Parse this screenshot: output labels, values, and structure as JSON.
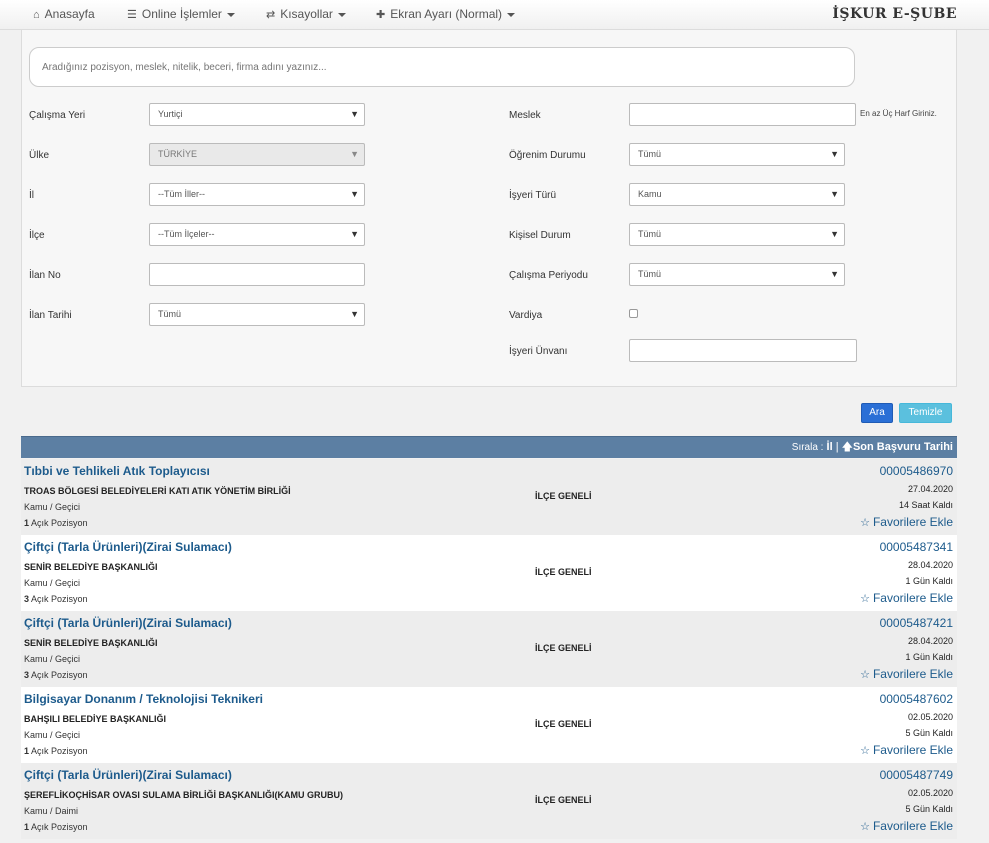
{
  "navbar": {
    "items": [
      {
        "label": "Anasayfa",
        "icon": "home-icon"
      },
      {
        "label": "Online İşlemler",
        "icon": "list-icon"
      },
      {
        "label": "Kısayollar",
        "icon": "shuffle-icon"
      },
      {
        "label": "Ekran Ayarı (Normal)",
        "icon": "expand-icon"
      }
    ],
    "brand": "İŞKUR E-ŞUBE"
  },
  "search": {
    "placeholder": "Aradığınız pozisyon, meslek, nitelik, beceri, firma adını yazınız..."
  },
  "filters": {
    "calisma_yeri": {
      "label": "Çalışma Yeri",
      "value": "Yurtiçi"
    },
    "ulke": {
      "label": "Ülke",
      "value": "TÜRKİYE"
    },
    "il": {
      "label": "İl",
      "value": "--Tüm İller--"
    },
    "ilce": {
      "label": "İlçe",
      "value": "--Tüm İlçeler--"
    },
    "ilan_no": {
      "label": "İlan No",
      "value": ""
    },
    "ilan_tarihi": {
      "label": "İlan Tarihi",
      "value": "Tümü"
    },
    "meslek": {
      "label": "Meslek",
      "value": "",
      "hint": "En az Üç Harf Giriniz."
    },
    "ogrenim_durumu": {
      "label": "Öğrenim Durumu",
      "value": "Tümü"
    },
    "isyeri_turu": {
      "label": "İşyeri Türü",
      "value": "Kamu"
    },
    "kisisel_durum": {
      "label": "Kişisel Durum",
      "value": "Tümü"
    },
    "calisma_periyodu": {
      "label": "Çalışma Periyodu",
      "value": "Tümü"
    },
    "vardiya": {
      "label": "Vardiya",
      "checked": false
    },
    "isyeri_unvani": {
      "label": "İşyeri Ünvanı",
      "value": ""
    }
  },
  "buttons": {
    "ara": "Ara",
    "temizle": "Temizle"
  },
  "sort": {
    "prefix": "Sırala :",
    "field_il": "İl",
    "separator": "|",
    "field_tarih": "Son Başvuru Tarihi"
  },
  "results": [
    {
      "title": "Tıbbi ve Tehlikeli Atık Toplayıcısı",
      "company": "TROAS BÖLGESİ BELEDİYELERİ KATI ATIK YÖNETİM BİRLİĞİ",
      "type": "Kamu / Geçici",
      "positions": "1",
      "positions_label": "Açık Pozisyon",
      "scope": "İLÇE GENELİ",
      "number": "00005486970",
      "date": "27.04.2020",
      "remaining": "14 Saat Kaldı",
      "fav": "Favorilere Ekle"
    },
    {
      "title": "Çiftçi (Tarla Ürünleri)(Zirai Sulamacı)",
      "company": "SENİR BELEDİYE BAŞKANLIĞI",
      "type": "Kamu / Geçici",
      "positions": "3",
      "positions_label": "Açık Pozisyon",
      "scope": "İLÇE GENELİ",
      "number": "00005487341",
      "date": "28.04.2020",
      "remaining": "1 Gün Kaldı",
      "fav": "Favorilere Ekle"
    },
    {
      "title": "Çiftçi (Tarla Ürünleri)(Zirai Sulamacı)",
      "company": "SENİR BELEDİYE BAŞKANLIĞI",
      "type": "Kamu / Geçici",
      "positions": "3",
      "positions_label": "Açık Pozisyon",
      "scope": "İLÇE GENELİ",
      "number": "00005487421",
      "date": "28.04.2020",
      "remaining": "1 Gün Kaldı",
      "fav": "Favorilere Ekle"
    },
    {
      "title": "Bilgisayar Donanım / Teknolojisi Teknikeri",
      "company": "BAHŞILI BELEDİYE BAŞKANLIĞI",
      "type": "Kamu / Geçici",
      "positions": "1",
      "positions_label": "Açık Pozisyon",
      "scope": "İLÇE GENELİ",
      "number": "00005487602",
      "date": "02.05.2020",
      "remaining": "5 Gün Kaldı",
      "fav": "Favorilere Ekle"
    },
    {
      "title": "Çiftçi (Tarla Ürünleri)(Zirai Sulamacı)",
      "company": "ŞEREFLİKOÇHİSAR OVASI SULAMA BİRLİĞİ BAŞKANLIĞI(KAMU GRUBU)",
      "type": "Kamu / Daimi",
      "positions": "1",
      "positions_label": "Açık Pozisyon",
      "scope": "İLÇE GENELİ",
      "number": "00005487749",
      "date": "02.05.2020",
      "remaining": "5 Gün Kaldı",
      "fav": "Favorilere Ekle"
    }
  ]
}
